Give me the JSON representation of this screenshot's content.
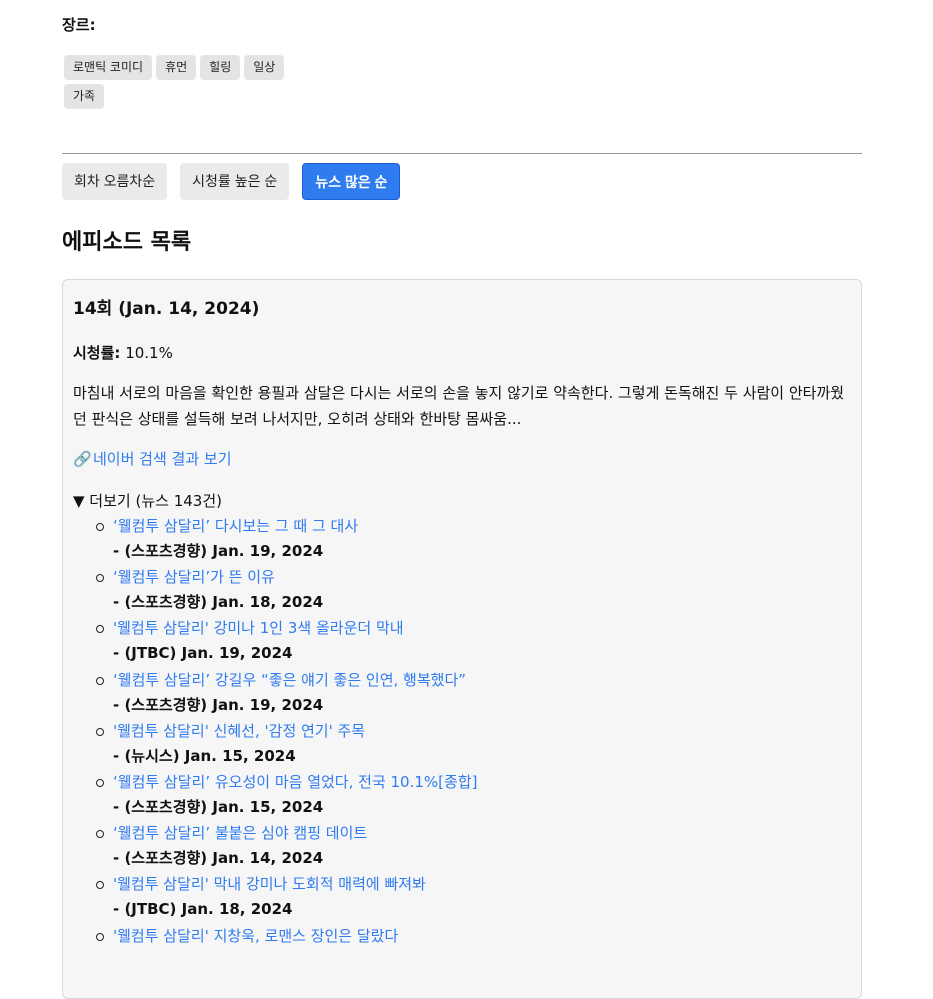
{
  "genre": {
    "label": "장르:",
    "tags": [
      "로맨틱 코미디",
      "휴먼",
      "힐링",
      "일상",
      "가족"
    ]
  },
  "sort": {
    "buttons": [
      "회차 오름차순",
      "시청률 높은 순",
      "뉴스 많은 순"
    ],
    "active_index": 2
  },
  "section_title": "에피소드 목록",
  "episode": {
    "title": "14회 (Jan. 14, 2024)",
    "rating_label": "시청률:",
    "rating_value": "10.1%",
    "summary": "마침내 서로의 마음을 확인한 용필과 삼달은 다시는 서로의 손을 놓지 않기로 약속한다. 그렇게 돈독해진 두 사람이 안타까웠던 판식은 상태를 설득해 보려 나서지만, 오히려 상태와 한바탕 몸싸움...",
    "naver_link_icon": "🔗",
    "naver_link_text": "네이버 검색 결과 보기",
    "more_label": "▼ 더보기 (뉴스 143건)",
    "news": [
      {
        "title": "‘웰컴투 삼달리’ 다시보는 그 때 그 대사",
        "meta": "- (스포츠경향) Jan. 19, 2024"
      },
      {
        "title": "‘웰컴투 삼달리’가 뜬 이유",
        "meta": "- (스포츠경향) Jan. 18, 2024"
      },
      {
        "title": "'웰컴투 삼달리' 강미나 1인 3색 올라운더 막내",
        "meta": "- (JTBC) Jan. 19, 2024"
      },
      {
        "title": "‘웰컴투 삼달리’ 강길우 “좋은 얘기 좋은 인연, 행복했다”",
        "meta": "- (스포츠경향) Jan. 19, 2024"
      },
      {
        "title": "'웰컴투 삼달리' 신혜선, '감정 연기' 주목",
        "meta": "- (뉴시스) Jan. 15, 2024"
      },
      {
        "title": "‘웰컴투 삼달리’ 유오성이 마음 열었다, 전국 10.1%[종합]",
        "meta": "- (스포츠경향) Jan. 15, 2024"
      },
      {
        "title": "‘웰컴투 삼달리’ 불붙은 심야 캠핑 데이트",
        "meta": "- (스포츠경향) Jan. 14, 2024"
      },
      {
        "title": "'웰컴투 삼달리' 막내 강미나 도회적 매력에 빠져봐",
        "meta": "- (JTBC) Jan. 18, 2024"
      },
      {
        "title": "'웰컴투 삼달리' 지창욱, 로맨스 장인은 달랐다",
        "meta": ""
      }
    ]
  },
  "colors": {
    "accent": "#2f7bf0",
    "tag_bg": "#e4e4e4",
    "card_bg": "#f6f6f6"
  }
}
